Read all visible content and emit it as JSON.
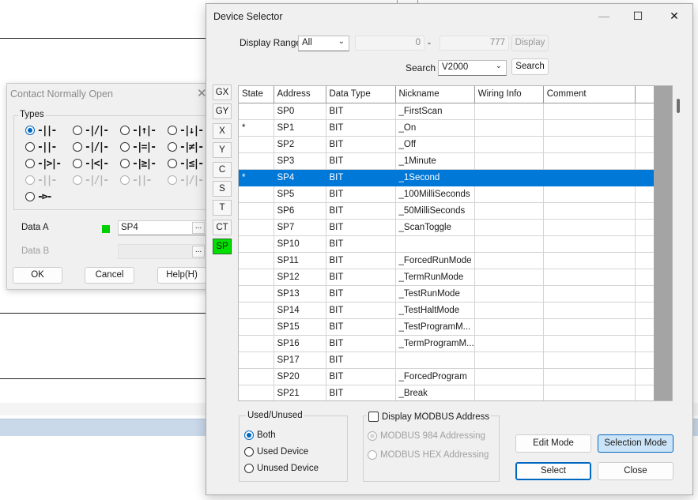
{
  "contact_dialog": {
    "title": "Contact Normally Open",
    "types_label": "Types",
    "types": [
      {
        "symbol": "-||-",
        "selected": true,
        "enabled": true
      },
      {
        "symbol": "-|/|-",
        "selected": false,
        "enabled": true
      },
      {
        "symbol": "-|↑|-",
        "selected": false,
        "enabled": true
      },
      {
        "symbol": "-|↓|-",
        "selected": false,
        "enabled": true
      },
      {
        "symbol": "-||-",
        "selected": false,
        "enabled": true
      },
      {
        "symbol": "-|/|-",
        "selected": false,
        "enabled": true
      },
      {
        "symbol": "-|=|-",
        "selected": false,
        "enabled": true
      },
      {
        "symbol": "-|≠|-",
        "selected": false,
        "enabled": true
      },
      {
        "symbol": "-|>|-",
        "selected": false,
        "enabled": true
      },
      {
        "symbol": "-|<|-",
        "selected": false,
        "enabled": true
      },
      {
        "symbol": "-|≥|-",
        "selected": false,
        "enabled": true
      },
      {
        "symbol": "-|≤|-",
        "selected": false,
        "enabled": true
      },
      {
        "symbol": "-||-",
        "selected": false,
        "enabled": false
      },
      {
        "symbol": "-|/|-",
        "selected": false,
        "enabled": false
      },
      {
        "symbol": "-||-",
        "selected": false,
        "enabled": false
      },
      {
        "symbol": "-|/|-",
        "selected": false,
        "enabled": false
      },
      {
        "symbol": "-⊳-",
        "selected": false,
        "enabled": true
      }
    ],
    "data_a_label": "Data A",
    "data_a_value": "SP4",
    "data_b_label": "Data B",
    "data_b_value": "",
    "browse_label": "...",
    "ok_label": "OK",
    "cancel_label": "Cancel",
    "help_label": "Help(H)",
    "close_glyph": "✕"
  },
  "device_selector": {
    "title": "Device Selector",
    "minimize_glyph": "—",
    "maximize_glyph": "☐",
    "close_glyph": "✕",
    "display_range_label": "Display Range",
    "display_range_value": "All",
    "range_from": "0",
    "range_sep": "-",
    "range_to": "777",
    "display_button": "Display",
    "search_label": "Search",
    "search_value": "V2000",
    "search_button": "Search",
    "device_types": [
      "GX",
      "GY",
      "X",
      "Y",
      "C",
      "S",
      "T",
      "CT",
      "SP"
    ],
    "active_device_type": "SP",
    "columns": [
      "State",
      "Address",
      "Data Type",
      "Nickname",
      "Wiring Info",
      "Comment"
    ],
    "rows": [
      {
        "state": "",
        "address": "SP0",
        "type": "BIT",
        "nickname": "_FirstScan",
        "wiring": "",
        "comment": ""
      },
      {
        "state": "*",
        "address": "SP1",
        "type": "BIT",
        "nickname": "_On",
        "wiring": "",
        "comment": ""
      },
      {
        "state": "",
        "address": "SP2",
        "type": "BIT",
        "nickname": "_Off",
        "wiring": "",
        "comment": ""
      },
      {
        "state": "",
        "address": "SP3",
        "type": "BIT",
        "nickname": "_1Minute",
        "wiring": "",
        "comment": ""
      },
      {
        "state": "*",
        "address": "SP4",
        "type": "BIT",
        "nickname": "_1Second",
        "wiring": "",
        "comment": "",
        "selected": true
      },
      {
        "state": "",
        "address": "SP5",
        "type": "BIT",
        "nickname": "_100MilliSeconds",
        "wiring": "",
        "comment": ""
      },
      {
        "state": "",
        "address": "SP6",
        "type": "BIT",
        "nickname": "_50MilliSeconds",
        "wiring": "",
        "comment": ""
      },
      {
        "state": "",
        "address": "SP7",
        "type": "BIT",
        "nickname": "_ScanToggle",
        "wiring": "",
        "comment": ""
      },
      {
        "state": "",
        "address": "SP10",
        "type": "BIT",
        "nickname": "",
        "wiring": "",
        "comment": ""
      },
      {
        "state": "",
        "address": "SP11",
        "type": "BIT",
        "nickname": "_ForcedRunMode",
        "wiring": "",
        "comment": ""
      },
      {
        "state": "",
        "address": "SP12",
        "type": "BIT",
        "nickname": "_TermRunMode",
        "wiring": "",
        "comment": ""
      },
      {
        "state": "",
        "address": "SP13",
        "type": "BIT",
        "nickname": "_TestRunMode",
        "wiring": "",
        "comment": ""
      },
      {
        "state": "",
        "address": "SP14",
        "type": "BIT",
        "nickname": "_TestHaltMode",
        "wiring": "",
        "comment": ""
      },
      {
        "state": "",
        "address": "SP15",
        "type": "BIT",
        "nickname": "_TestProgramM...",
        "wiring": "",
        "comment": ""
      },
      {
        "state": "",
        "address": "SP16",
        "type": "BIT",
        "nickname": "_TermProgramM...",
        "wiring": "",
        "comment": ""
      },
      {
        "state": "",
        "address": "SP17",
        "type": "BIT",
        "nickname": "",
        "wiring": "",
        "comment": ""
      },
      {
        "state": "",
        "address": "SP20",
        "type": "BIT",
        "nickname": "_ForcedProgram",
        "wiring": "",
        "comment": ""
      },
      {
        "state": "",
        "address": "SP21",
        "type": "BIT",
        "nickname": "_Break",
        "wiring": "",
        "comment": ""
      }
    ],
    "used_unused_label": "Used/Unused",
    "used_options": [
      {
        "label": "Both",
        "selected": true
      },
      {
        "label": "Used Device",
        "selected": false
      },
      {
        "label": "Unused Device",
        "selected": false
      }
    ],
    "modbus_checkbox_label": "Display MODBUS Address",
    "modbus_options": [
      {
        "label": "MODBUS 984 Addressing",
        "selected": true
      },
      {
        "label": "MODBUS HEX Addressing",
        "selected": false
      }
    ],
    "edit_mode_button": "Edit Mode",
    "selection_mode_button": "Selection Mode",
    "select_button": "Select",
    "close_button": "Close"
  },
  "colors": {
    "selection": "#0078d7",
    "active_device": "#00e000",
    "data_a_indicator": "#00d000"
  }
}
